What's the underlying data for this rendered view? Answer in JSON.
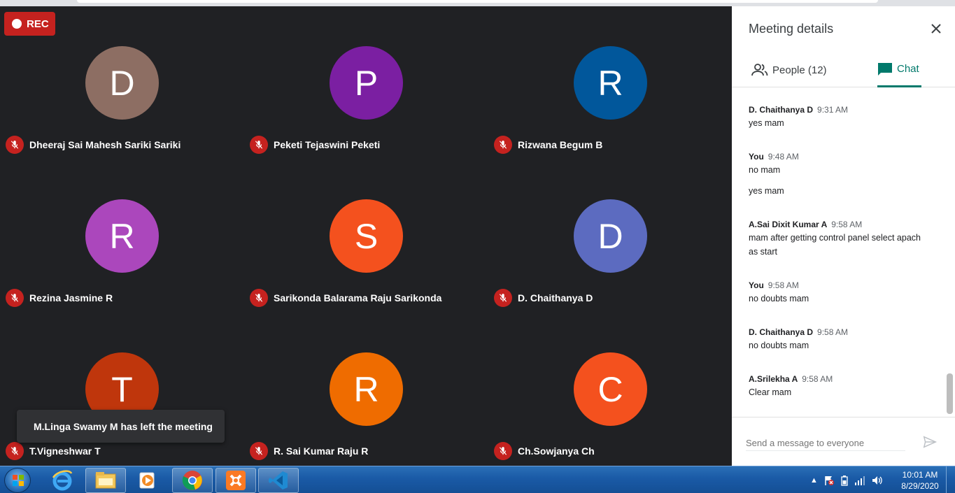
{
  "recording": {
    "label": "REC"
  },
  "participants": [
    {
      "initial": "D",
      "name": "Dheeraj Sai Mahesh Sariki Sariki",
      "color": "#8d6e63"
    },
    {
      "initial": "P",
      "name": "Peketi Tejaswini Peketi",
      "color": "#7b1fa2"
    },
    {
      "initial": "R",
      "name": "Rizwana Begum B",
      "color": "#01579b"
    },
    {
      "initial": "R",
      "name": "Rezina Jasmine R",
      "color": "#ab47bc"
    },
    {
      "initial": "S",
      "name": "Sarikonda Balarama Raju Sarikonda",
      "color": "#f4511e"
    },
    {
      "initial": "D",
      "name": "D. Chaithanya D",
      "color": "#5c6bc0"
    },
    {
      "initial": "T",
      "name": "T.Vigneshwar T",
      "color": "#bf360c"
    },
    {
      "initial": "R",
      "name": "R. Sai Kumar Raju R",
      "color": "#ef6c00"
    },
    {
      "initial": "C",
      "name": "Ch.Sowjanya Ch",
      "color": "#f4511e"
    }
  ],
  "toast": {
    "text": "M.Linga Swamy M has left the meeting"
  },
  "panel": {
    "title": "Meeting details",
    "tabs": {
      "people": "People (12)",
      "chat": "Chat"
    },
    "messages": [
      {
        "sender": "D. Chaithanya D",
        "time": "9:31 AM",
        "lines": [
          "yes mam"
        ]
      },
      {
        "sender": "You",
        "time": "9:48 AM",
        "lines": [
          "no mam",
          "yes mam"
        ]
      },
      {
        "sender": "A.Sai Dixit Kumar A",
        "time": "9:58 AM",
        "lines": [
          "mam after getting control panel select apach as start"
        ]
      },
      {
        "sender": "You",
        "time": "9:58 AM",
        "lines": [
          "no doubts mam"
        ]
      },
      {
        "sender": "D. Chaithanya D",
        "time": "9:58 AM",
        "lines": [
          "no doubts mam"
        ]
      },
      {
        "sender": "A.Srilekha A",
        "time": "9:58 AM",
        "lines": [
          "Clear mam"
        ]
      }
    ],
    "composer": {
      "placeholder": "Send a message to everyone"
    }
  },
  "taskbar": {
    "apps": [
      "internet-explorer",
      "file-explorer",
      "media-player",
      "chrome",
      "xampp",
      "vscode"
    ],
    "clock": {
      "time": "10:01 AM",
      "date": "8/29/2020"
    }
  },
  "colors": {
    "accent": "#00796b",
    "muted_mic": "#c5221f",
    "grid_bg": "#202124"
  }
}
